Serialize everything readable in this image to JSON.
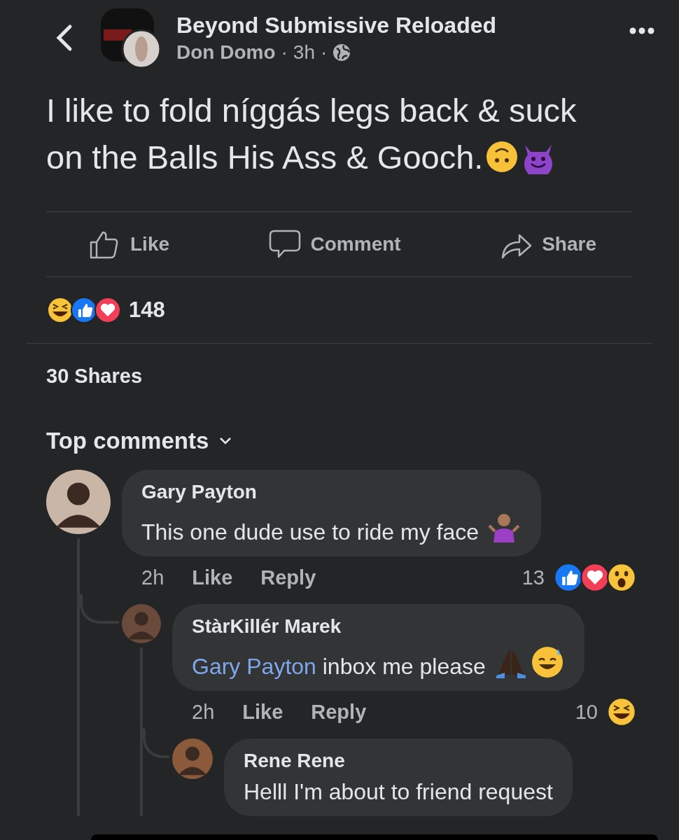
{
  "header": {
    "page_name": "Beyond Submissive Reloaded",
    "author": "Don Domo",
    "separator": "·",
    "time": "3h"
  },
  "post": {
    "text": "I like to fold níggás legs back & suck on the Balls His Ass & Gooch."
  },
  "actions": [
    {
      "kind": "like",
      "label": "Like"
    },
    {
      "kind": "comment",
      "label": "Comment"
    },
    {
      "kind": "share",
      "label": "Share"
    }
  ],
  "reactions": {
    "count": "148"
  },
  "shares": "30 Shares",
  "comments_heading": "Top comments",
  "comments": [
    {
      "author": "Gary Payton",
      "text": "This one dude use to ride my face",
      "time": "2h",
      "actions": [
        "Like",
        "Reply"
      ],
      "reaction_count": "13",
      "children": [
        {
          "author": "StàrKillér Marek",
          "mention": "Gary Payton",
          "text": "inbox me please",
          "time": "2h",
          "actions": [
            "Like",
            "Reply"
          ],
          "reaction_count": "10",
          "children": [
            {
              "author": "Rene Rene",
              "text": "Helll I'm about to friend request"
            }
          ]
        }
      ]
    }
  ]
}
